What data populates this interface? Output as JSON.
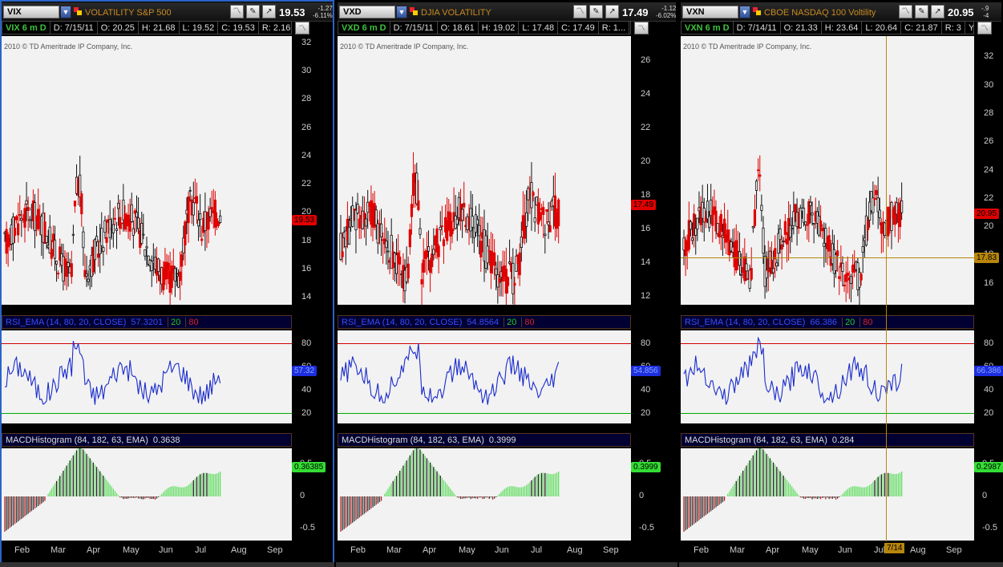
{
  "panes": [
    {
      "symbol": "VIX",
      "description": "VOLATILITY S&P 500",
      "last": "19.53",
      "change": "-1.27",
      "change_pct": "-6.11%",
      "info": {
        "timeframe": "VIX 6 m D",
        "date": "D: 7/15/11",
        "open": "O: 20.25",
        "high": "H: 21.68",
        "low": "L: 19.52",
        "close": "C: 19.53",
        "range": "R: 2.16",
        "extra": ""
      },
      "copyright": "2010 © TD Ameritrade IP Company, Inc.",
      "price_axis": [
        "32",
        "30",
        "28",
        "26",
        "24",
        "22",
        "20",
        "18",
        "16",
        "14"
      ],
      "price_range": [
        13.5,
        32.5
      ],
      "last_tag": "19.53",
      "rsi_label": "RSI_EMA (14, 80, 20, CLOSE)",
      "rsi_value": "57.3201",
      "rsi_ob": "20",
      "rsi_os": "80",
      "rsi_tag": "57.32",
      "rsi_axis": [
        "80",
        "60",
        "40",
        "20"
      ],
      "macd_label": "MACDHistogram (84, 182, 63, EMA)",
      "macd_value": "0.3638",
      "macd_tag": "0.36385",
      "macd_axis": [
        "0.5",
        "0",
        "-0.5"
      ],
      "months": [
        "Feb",
        "Mar",
        "Apr",
        "May",
        "Jun",
        "Jul",
        "Aug",
        "Sep"
      ],
      "crosshair_tag": "",
      "date_tag": ""
    },
    {
      "symbol": "VXD",
      "description": "DJIA VOLATILITY",
      "last": "17.49",
      "change": "-1.12",
      "change_pct": "-6.02%",
      "info": {
        "timeframe": "VXD 6 m D",
        "date": "D: 7/15/11",
        "open": "O: 18.61",
        "high": "H: 19.02",
        "low": "L: 17.48",
        "close": "C: 17.49",
        "range": "R: 1...",
        "extra": ""
      },
      "copyright": "2010 © TD Ameritrade IP Company, Inc.",
      "price_axis": [
        "26",
        "24",
        "22",
        "20",
        "18",
        "16",
        "14",
        "12"
      ],
      "price_range": [
        11.5,
        27.5
      ],
      "last_tag": "17.49",
      "rsi_label": "RSI_EMA (14, 80, 20, CLOSE)",
      "rsi_value": "54.8564",
      "rsi_ob": "20",
      "rsi_os": "80",
      "rsi_tag": "54.856",
      "rsi_axis": [
        "80",
        "60",
        "40",
        "20"
      ],
      "macd_label": "MACDHistogram (84, 182, 63, EMA)",
      "macd_value": "0.3999",
      "macd_tag": "0.3999",
      "macd_axis": [
        "0.5",
        "0",
        "-0.5"
      ],
      "months": [
        "Feb",
        "Mar",
        "Apr",
        "May",
        "Jun",
        "Jul",
        "Aug",
        "Sep"
      ],
      "crosshair_tag": "",
      "date_tag": ""
    },
    {
      "symbol": "VXN",
      "description": "CBOE NASDAQ 100 Voltility",
      "last": "20.95",
      "change": "-.9",
      "change_pct": "-4",
      "info": {
        "timeframe": "VXN 6 m D",
        "date": "D: 7/14/11",
        "open": "O: 21.33",
        "high": "H: 23.64",
        "low": "L: 20.64",
        "close": "C: 21.87",
        "range": "R: 3",
        "extra": "Y..."
      },
      "copyright": "2010 © TD Ameritrade IP Company, Inc.",
      "price_axis": [
        "32",
        "30",
        "28",
        "26",
        "24",
        "22",
        "20",
        "18",
        "16"
      ],
      "price_range": [
        14.5,
        33.5
      ],
      "last_tag": "20.95",
      "rsi_label": "RSI_EMA (14, 80, 20, CLOSE)",
      "rsi_value": "66.386",
      "rsi_ob": "20",
      "rsi_os": "80",
      "rsi_tag": "66.386",
      "rsi_axis": [
        "80",
        "60",
        "40",
        "20"
      ],
      "macd_label": "MACDHistogram (84, 182, 63, EMA)",
      "macd_value": "0.284",
      "macd_tag": "0.2987",
      "macd_axis": [
        "0.5",
        "0",
        "-0.5"
      ],
      "months": [
        "Feb",
        "Mar",
        "Apr",
        "May",
        "Jun",
        "Jul",
        "Aug",
        "Sep"
      ],
      "crosshair_tag": "17.83",
      "date_tag": "7/14"
    }
  ],
  "colors": {
    "up": "#111111",
    "down": "#e00000",
    "rsi_line": "#1a2ccc",
    "rsi_upper": "#d00000",
    "rsi_lower": "#00aa00",
    "macd_pos": "#66dd66",
    "macd_neg": "#bb2222",
    "last_tag_bg": "#e00000",
    "rsi_tag_bg": "#1d2ee0",
    "macd_tag_bg": "#33dd33",
    "crosshair": "#b8860b"
  }
}
